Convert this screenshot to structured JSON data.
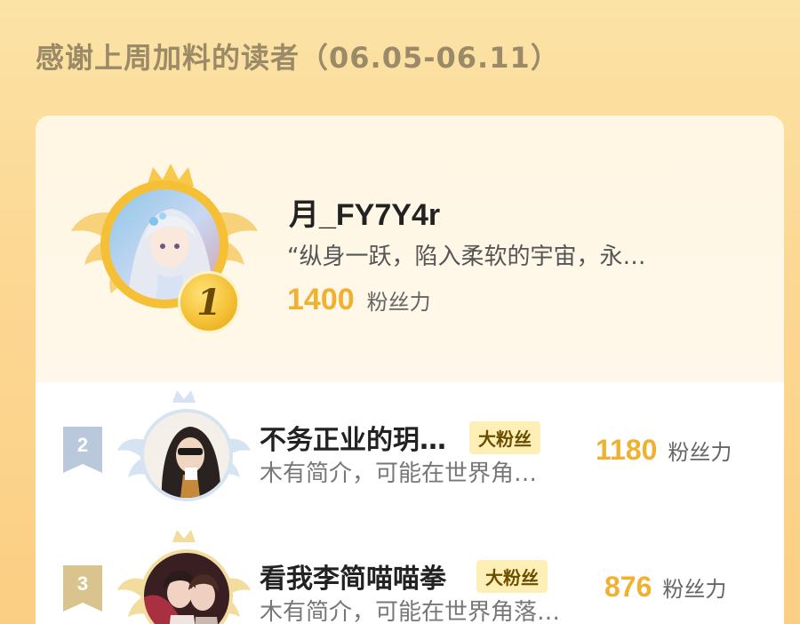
{
  "header": {
    "title": "感谢上周加料的读者（06.05-06.11）"
  },
  "top_reader": {
    "rank": "1",
    "name": "月_FY7Y4r",
    "quote": "“纵身一跃，陷入柔软的宇宙，永…",
    "score": "1400",
    "score_label": "粉丝力"
  },
  "readers": [
    {
      "rank": "2",
      "name": "不务正业的玥…",
      "tag": "大粉丝",
      "intro": "木有简介，可能在世界角…",
      "score": "1180",
      "score_label": "粉丝力"
    },
    {
      "rank": "3",
      "name": "看我李简喵喵拳",
      "tag": "大粉丝",
      "intro": "木有简介，可能在世界角落…",
      "score": "876",
      "score_label": "粉丝力"
    }
  ],
  "colors": {
    "gold": "#f0b030",
    "silver_badge": "#b9c9db",
    "bronze_badge": "#d9c48e"
  },
  "icons": [
    "crown-icon",
    "wing-icon",
    "rank-badge-icon"
  ]
}
